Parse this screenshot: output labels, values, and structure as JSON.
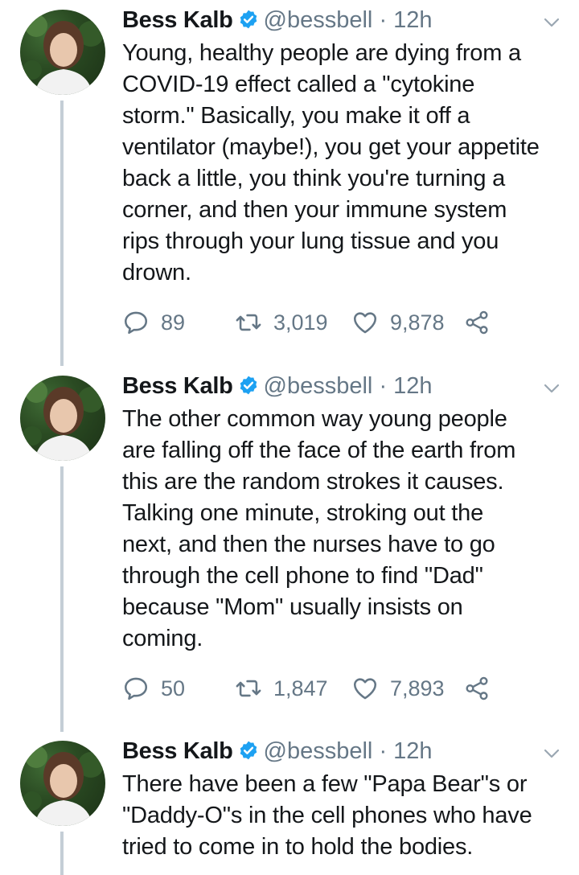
{
  "tweets": [
    {
      "name": "Bess Kalb",
      "handle": "@bessbell",
      "dot": "·",
      "time": "12h",
      "text": "Young, healthy people are dying from a\nCOVID-19 effect called a \"cytokine\nstorm.\" Basically, you make it off a\nventilator (maybe!), you get your appetite\nback a little, you think you're turning a\ncorner, and then your immune system\nrips through your lung tissue and you\ndrown.",
      "replies": "89",
      "retweets": "3,019",
      "likes": "9,878"
    },
    {
      "name": "Bess Kalb",
      "handle": "@bessbell",
      "dot": "·",
      "time": "12h",
      "text": "The other common way young people\nare falling off the face of the earth from\nthis are the random strokes it causes.\nTalking one minute, stroking out the\nnext, and then the nurses have to go\nthrough the cell phone to find \"Dad\"\nbecause \"Mom\" usually insists on\ncoming.",
      "replies": "50",
      "retweets": "1,847",
      "likes": "7,893"
    },
    {
      "name": "Bess Kalb",
      "handle": "@bessbell",
      "dot": "·",
      "time": "12h",
      "text": "There have been a few \"Papa Bear\"s or\n\"Daddy-O\"s in the cell phones who have\ntried to come in to hold the bodies."
    }
  ],
  "icons": {
    "verified": "verified-badge-icon",
    "caret": "chevron-down-icon",
    "reply": "reply-icon",
    "retweet": "retweet-icon",
    "like": "heart-icon",
    "share": "share-icon"
  },
  "colors": {
    "verified": "#1da1f2",
    "muted": "#657786",
    "thread_line": "#c4ced6"
  }
}
